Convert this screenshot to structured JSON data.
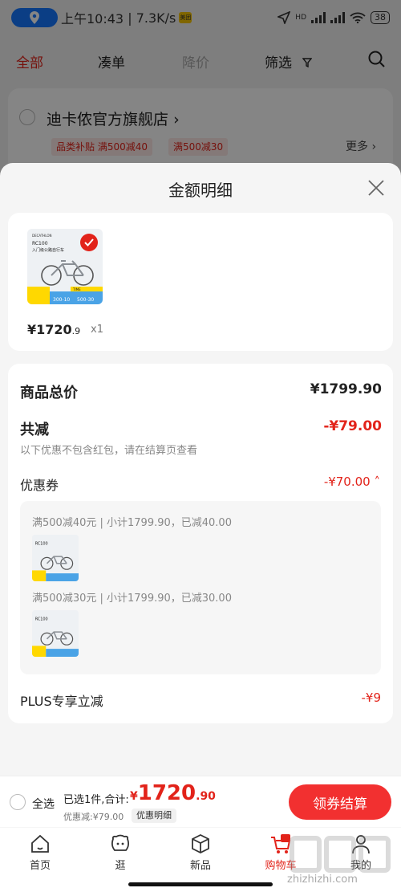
{
  "status": {
    "time": "上午10:43",
    "speed": "7.3K/s",
    "hd": "HD",
    "battery": "38",
    "mi": "美团"
  },
  "cart_tabs": {
    "all": "全部",
    "cou": "凑单",
    "down": "降价",
    "filter": "筛选"
  },
  "store": {
    "name": "迪卡侬官方旗舰店",
    "tag1": "品类补贴 满500减40",
    "tag2": "满500减30",
    "more": "更多"
  },
  "sheet": {
    "title": "金额明细"
  },
  "product": {
    "price_int": "¥1720",
    "price_dec": ".9",
    "qty": "x1",
    "thumb": {
      "brand": "DECATHLON",
      "model": "RC100",
      "desc": "入门级公路自行车",
      "promo1": "300-10",
      "promo2": "500-30",
      "pill": "TIME"
    }
  },
  "detail": {
    "total_label": "商品总价",
    "total_value": "¥1799.90",
    "reduce_label": "共减",
    "reduce_value": "-¥79.00",
    "note": "以下优惠不包含红包，请在结算页查看",
    "coupon_label": "优惠券",
    "coupon_value": "-¥70.00",
    "coupon1": "满500减40元 | 小计1799.90，已减40.00",
    "coupon2": "满500减30元 | 小计1799.90，已减30.00",
    "plus_label": "PLUS专享立减",
    "plus_value": "-¥9"
  },
  "checkout": {
    "all": "全选",
    "selected": "已选1件,合计:",
    "cur": "¥",
    "price_int": "1720",
    "price_dec": ".90",
    "discount": "优惠减:¥79.00",
    "detail_pill": "优惠明细",
    "pay": "领券结算"
  },
  "nav": {
    "home": "首页",
    "explore": "逛",
    "new": "新品",
    "cart": "购物车",
    "mine": "我的"
  },
  "watermark": "zhizhizhi.com",
  "colors": {
    "accent": "#e2231a",
    "pay": "#f23030",
    "location": "#1677ff"
  }
}
